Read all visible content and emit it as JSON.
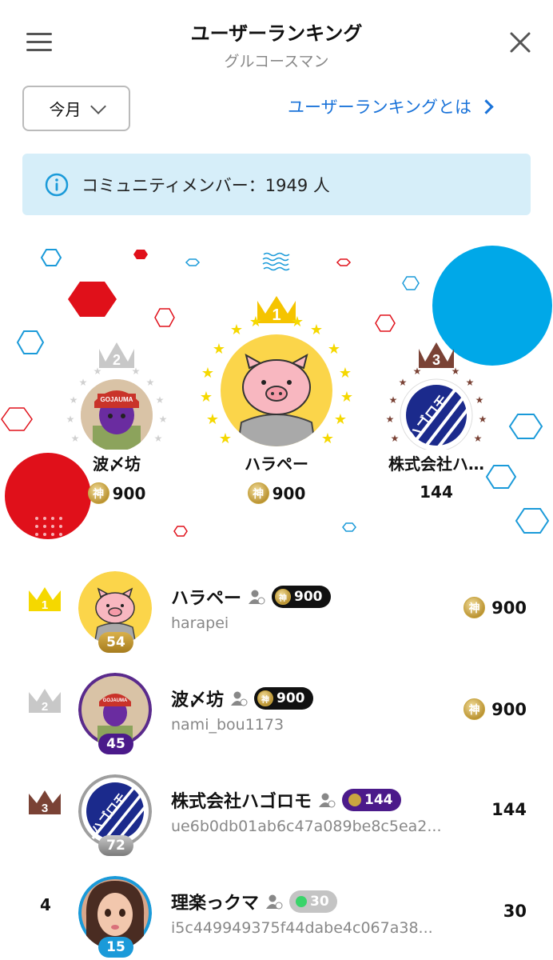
{
  "header": {
    "title": "ユーザーランキング",
    "subtitle": "グルコースマン"
  },
  "controls": {
    "period_label": "今月",
    "about_link": "ユーザーランキングとは"
  },
  "info_banner": {
    "text": "コミュニティメンバー：1949 人"
  },
  "podium": [
    {
      "rank": "2",
      "name": "波〆坊",
      "points": "900",
      "coin_label": "神"
    },
    {
      "rank": "1",
      "name": "ハラペー",
      "points": "900",
      "coin_label": "神"
    },
    {
      "rank": "3",
      "name": "株式会社ハ…",
      "points": "144"
    }
  ],
  "ranking": [
    {
      "rank": "1",
      "name": "ハラペー",
      "user_id": "harapei",
      "level": "54",
      "pill_score": "900",
      "pill_coin": "神",
      "score": "900",
      "score_coin": "神"
    },
    {
      "rank": "2",
      "name": "波〆坊",
      "user_id": "nami_bou1173",
      "level": "45",
      "pill_score": "900",
      "pill_coin": "神",
      "score": "900",
      "score_coin": "神"
    },
    {
      "rank": "3",
      "name": "株式会社ハゴロモ",
      "user_id": "ue6b0db01ab6c47a089be8c5ea2...",
      "level": "72",
      "pill_score": "144",
      "score": "144"
    },
    {
      "rank": "4",
      "name": "理楽っクマ",
      "user_id": "i5c449949375f44dabe4c067a38...",
      "level": "15",
      "pill_score": "30",
      "score": "30"
    }
  ],
  "avatar_text": {
    "cap_text": "GOJAUMA",
    "logo_text": "ハゴロモ"
  },
  "colors": {
    "accent_blue": "#1a73d9",
    "banner_bg": "#d6eef9",
    "gold": "#f5c400",
    "silver": "#c8c8c8",
    "bronze": "#7a4235",
    "pill_black": "#111111",
    "pill_purple": "#4b1a8a",
    "pill_gray": "#c4c4c4",
    "deco_red": "#e0101a",
    "deco_blue": "#00a8e8"
  },
  "icons": [
    "menu-icon",
    "close-icon",
    "chevron-down-icon",
    "chevron-right-icon",
    "info-icon",
    "crown-icon",
    "person-icon",
    "kami-coin-icon"
  ]
}
